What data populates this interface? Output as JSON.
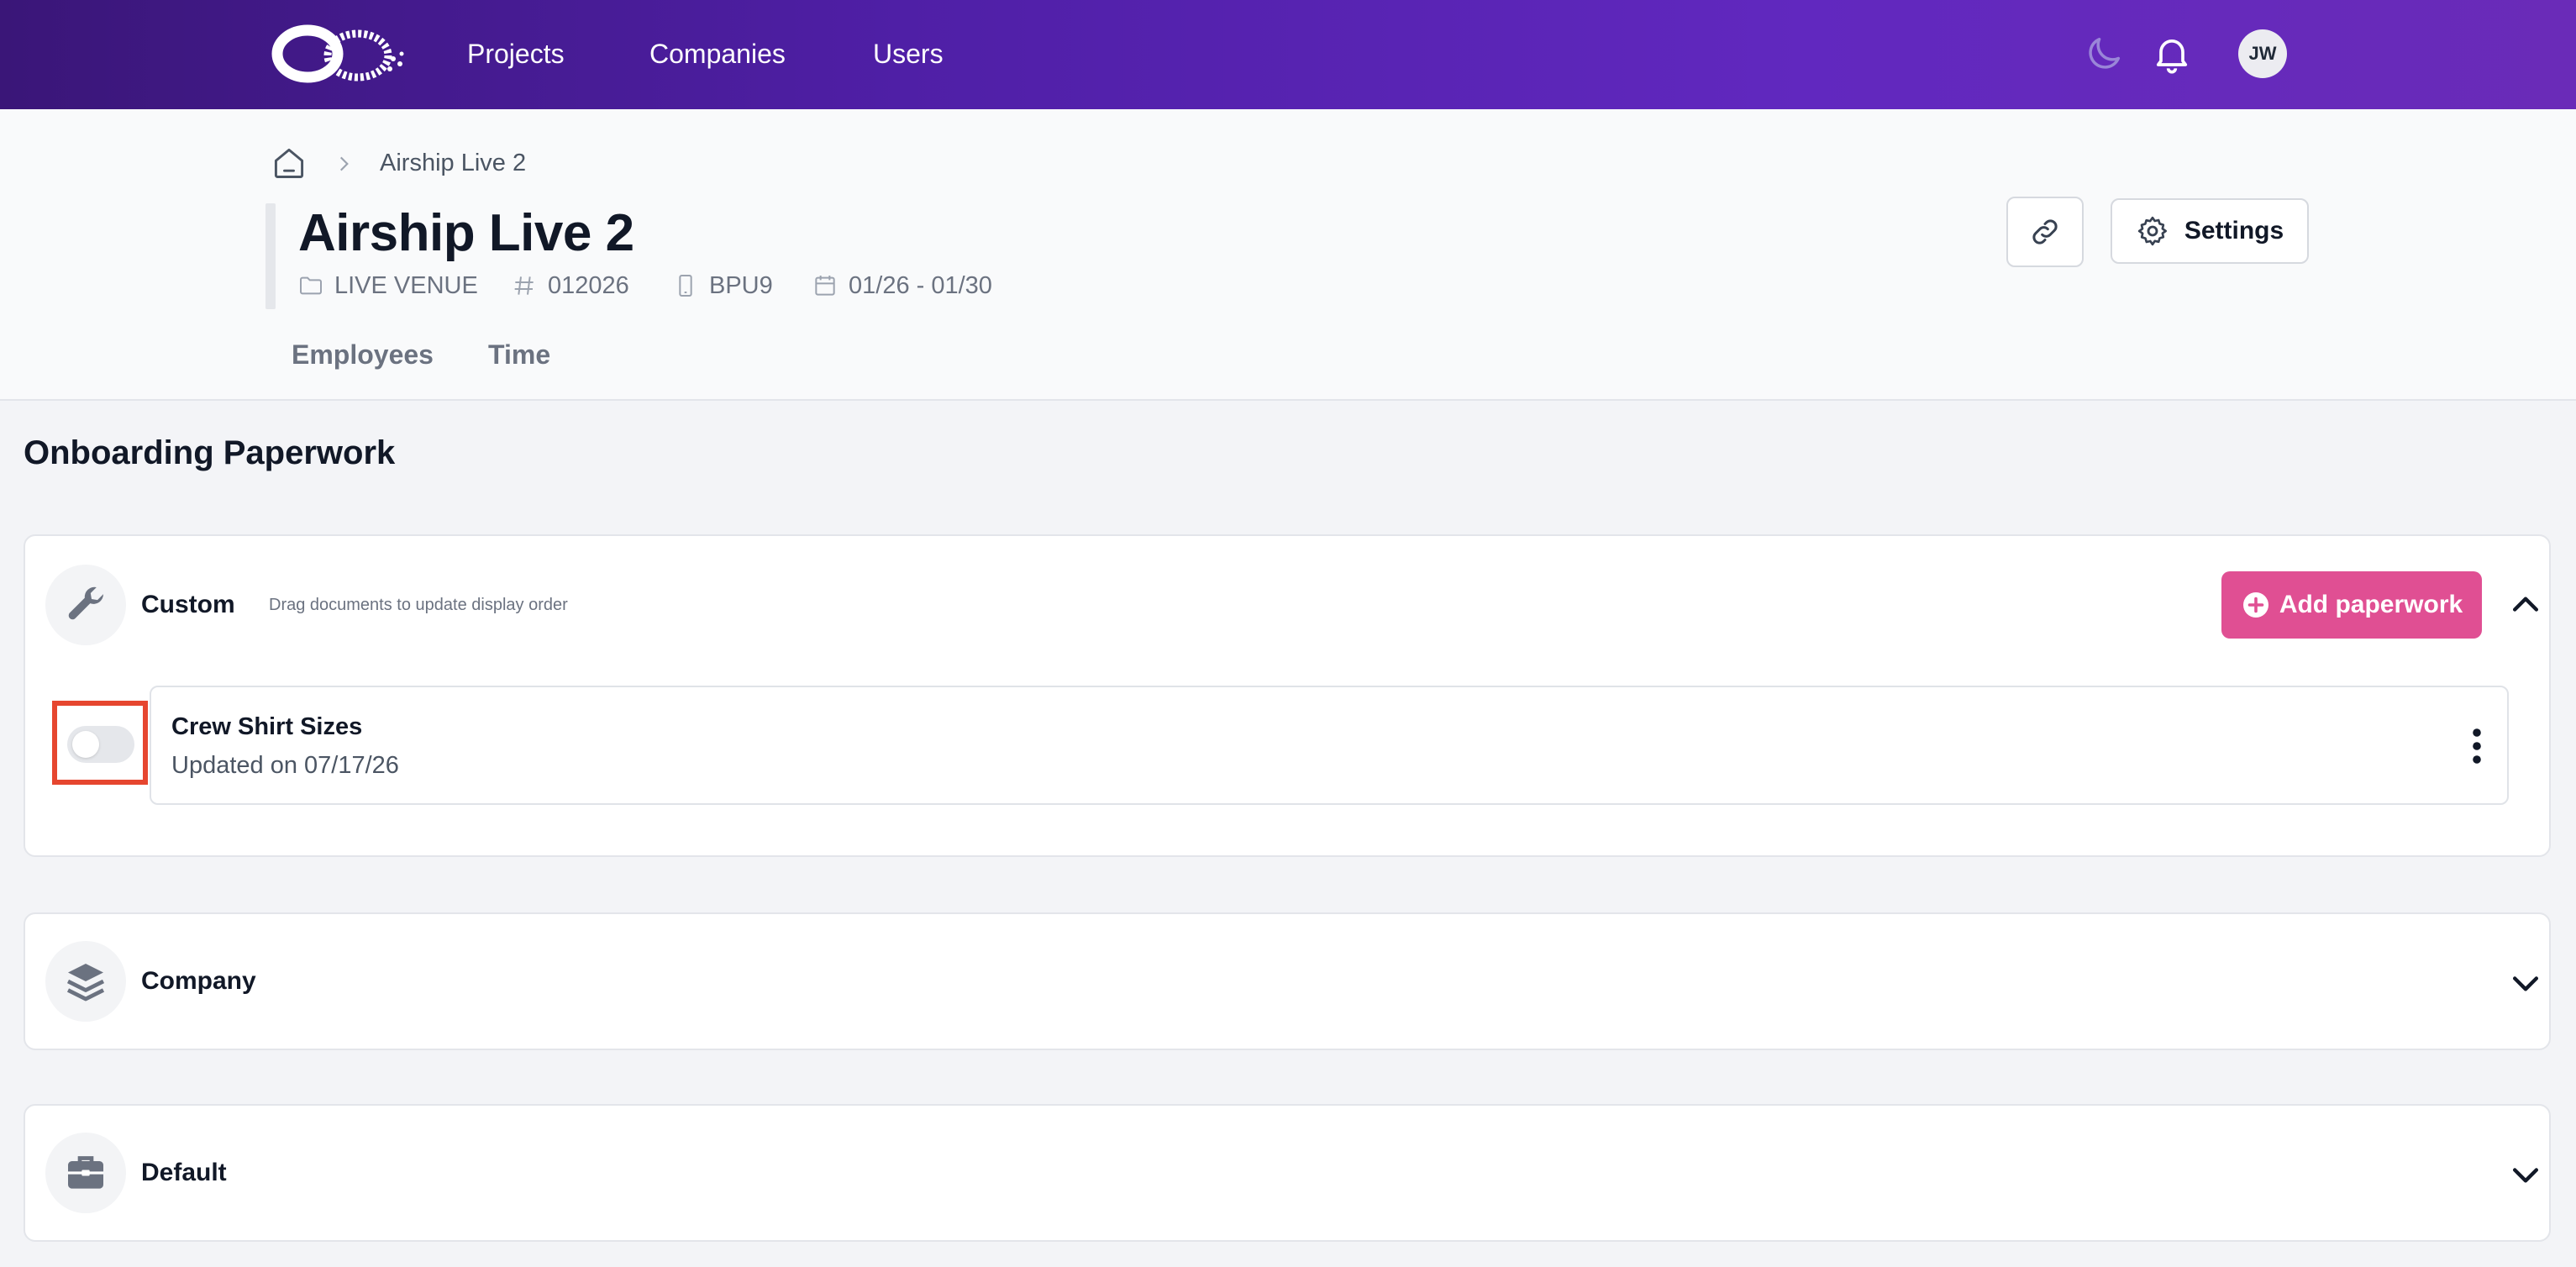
{
  "nav": {
    "links": [
      "Projects",
      "Companies",
      "Users"
    ],
    "avatar_initials": "JW",
    "icons": [
      "logo-icon",
      "moon-icon",
      "bell-icon"
    ]
  },
  "breadcrumb": {
    "current": "Airship Live 2"
  },
  "project": {
    "title": "Airship Live 2",
    "type": "LIVE VENUE",
    "number": "012026",
    "code": "BPU9",
    "dates": "01/26 - 01/30"
  },
  "tabs": [
    "Employees",
    "Time"
  ],
  "actions": {
    "settings_label": "Settings"
  },
  "section": {
    "heading": "Onboarding Paperwork"
  },
  "cards": {
    "custom": {
      "title": "Custom",
      "hint": "Drag documents to update display order",
      "add_label": "Add paperwork",
      "documents": [
        {
          "name": "Crew Shirt Sizes",
          "updated": "Updated on 07/17/26",
          "enabled": false
        }
      ]
    },
    "company": {
      "title": "Company"
    },
    "default": {
      "title": "Default"
    }
  },
  "colors": {
    "nav_gradient_start": "#3a1678",
    "nav_gradient_end": "#6a2bb8",
    "accent_pink": "#e04f93",
    "highlight_red": "#e6462f"
  }
}
